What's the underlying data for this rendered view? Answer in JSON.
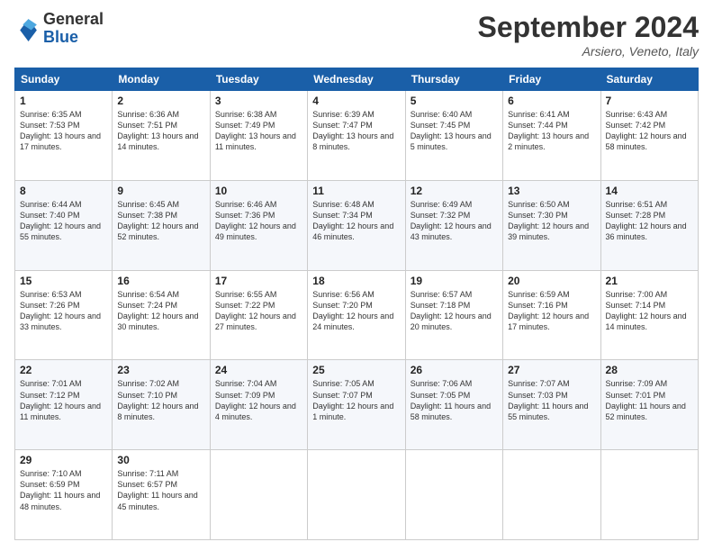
{
  "logo": {
    "text_general": "General",
    "text_blue": "Blue"
  },
  "title": "September 2024",
  "location": "Arsiero, Veneto, Italy",
  "weekdays": [
    "Sunday",
    "Monday",
    "Tuesday",
    "Wednesday",
    "Thursday",
    "Friday",
    "Saturday"
  ],
  "weeks": [
    [
      {
        "day": "1",
        "sunrise": "6:35 AM",
        "sunset": "7:53 PM",
        "daylight": "13 hours and 17 minutes."
      },
      {
        "day": "2",
        "sunrise": "6:36 AM",
        "sunset": "7:51 PM",
        "daylight": "13 hours and 14 minutes."
      },
      {
        "day": "3",
        "sunrise": "6:38 AM",
        "sunset": "7:49 PM",
        "daylight": "13 hours and 11 minutes."
      },
      {
        "day": "4",
        "sunrise": "6:39 AM",
        "sunset": "7:47 PM",
        "daylight": "13 hours and 8 minutes."
      },
      {
        "day": "5",
        "sunrise": "6:40 AM",
        "sunset": "7:45 PM",
        "daylight": "13 hours and 5 minutes."
      },
      {
        "day": "6",
        "sunrise": "6:41 AM",
        "sunset": "7:44 PM",
        "daylight": "13 hours and 2 minutes."
      },
      {
        "day": "7",
        "sunrise": "6:43 AM",
        "sunset": "7:42 PM",
        "daylight": "12 hours and 58 minutes."
      }
    ],
    [
      {
        "day": "8",
        "sunrise": "6:44 AM",
        "sunset": "7:40 PM",
        "daylight": "12 hours and 55 minutes."
      },
      {
        "day": "9",
        "sunrise": "6:45 AM",
        "sunset": "7:38 PM",
        "daylight": "12 hours and 52 minutes."
      },
      {
        "day": "10",
        "sunrise": "6:46 AM",
        "sunset": "7:36 PM",
        "daylight": "12 hours and 49 minutes."
      },
      {
        "day": "11",
        "sunrise": "6:48 AM",
        "sunset": "7:34 PM",
        "daylight": "12 hours and 46 minutes."
      },
      {
        "day": "12",
        "sunrise": "6:49 AM",
        "sunset": "7:32 PM",
        "daylight": "12 hours and 43 minutes."
      },
      {
        "day": "13",
        "sunrise": "6:50 AM",
        "sunset": "7:30 PM",
        "daylight": "12 hours and 39 minutes."
      },
      {
        "day": "14",
        "sunrise": "6:51 AM",
        "sunset": "7:28 PM",
        "daylight": "12 hours and 36 minutes."
      }
    ],
    [
      {
        "day": "15",
        "sunrise": "6:53 AM",
        "sunset": "7:26 PM",
        "daylight": "12 hours and 33 minutes."
      },
      {
        "day": "16",
        "sunrise": "6:54 AM",
        "sunset": "7:24 PM",
        "daylight": "12 hours and 30 minutes."
      },
      {
        "day": "17",
        "sunrise": "6:55 AM",
        "sunset": "7:22 PM",
        "daylight": "12 hours and 27 minutes."
      },
      {
        "day": "18",
        "sunrise": "6:56 AM",
        "sunset": "7:20 PM",
        "daylight": "12 hours and 24 minutes."
      },
      {
        "day": "19",
        "sunrise": "6:57 AM",
        "sunset": "7:18 PM",
        "daylight": "12 hours and 20 minutes."
      },
      {
        "day": "20",
        "sunrise": "6:59 AM",
        "sunset": "7:16 PM",
        "daylight": "12 hours and 17 minutes."
      },
      {
        "day": "21",
        "sunrise": "7:00 AM",
        "sunset": "7:14 PM",
        "daylight": "12 hours and 14 minutes."
      }
    ],
    [
      {
        "day": "22",
        "sunrise": "7:01 AM",
        "sunset": "7:12 PM",
        "daylight": "12 hours and 11 minutes."
      },
      {
        "day": "23",
        "sunrise": "7:02 AM",
        "sunset": "7:10 PM",
        "daylight": "12 hours and 8 minutes."
      },
      {
        "day": "24",
        "sunrise": "7:04 AM",
        "sunset": "7:09 PM",
        "daylight": "12 hours and 4 minutes."
      },
      {
        "day": "25",
        "sunrise": "7:05 AM",
        "sunset": "7:07 PM",
        "daylight": "12 hours and 1 minute."
      },
      {
        "day": "26",
        "sunrise": "7:06 AM",
        "sunset": "7:05 PM",
        "daylight": "11 hours and 58 minutes."
      },
      {
        "day": "27",
        "sunrise": "7:07 AM",
        "sunset": "7:03 PM",
        "daylight": "11 hours and 55 minutes."
      },
      {
        "day": "28",
        "sunrise": "7:09 AM",
        "sunset": "7:01 PM",
        "daylight": "11 hours and 52 minutes."
      }
    ],
    [
      {
        "day": "29",
        "sunrise": "7:10 AM",
        "sunset": "6:59 PM",
        "daylight": "11 hours and 48 minutes."
      },
      {
        "day": "30",
        "sunrise": "7:11 AM",
        "sunset": "6:57 PM",
        "daylight": "11 hours and 45 minutes."
      },
      null,
      null,
      null,
      null,
      null
    ]
  ]
}
